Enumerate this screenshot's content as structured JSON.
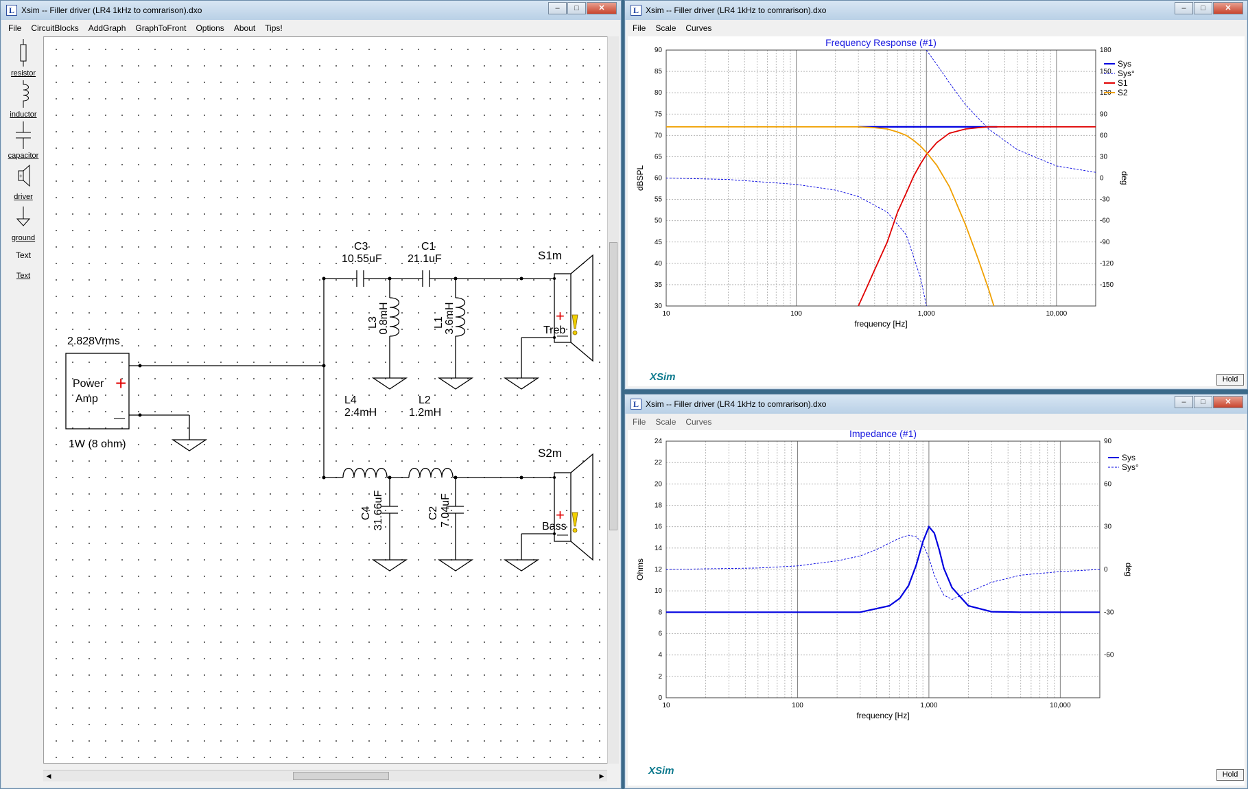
{
  "left_window": {
    "title": "Xsim -- Filler driver (LR4 1kHz to comrarison).dxo",
    "menu": [
      "File",
      "CircuitBlocks",
      "AddGraph",
      "GraphToFront",
      "Options",
      "About",
      "Tips!"
    ],
    "toolbox": [
      {
        "label": "resistor",
        "icon": "resistor-icon"
      },
      {
        "label": "inductor",
        "icon": "inductor-icon"
      },
      {
        "label": "capacitor",
        "icon": "capacitor-icon"
      },
      {
        "label": "driver",
        "icon": "driver-icon"
      },
      {
        "label": "ground",
        "icon": "ground-icon"
      },
      {
        "label": "Text",
        "icon": ""
      },
      {
        "label": "Text",
        "icon": ""
      }
    ],
    "schematic": {
      "source_voltage": "2.828Vrms",
      "amp_label_1": "Power",
      "amp_label_2": "Amp",
      "amp_power": "1W (8 ohm)",
      "plus": "+",
      "minus": "—",
      "c3_name": "C3",
      "c3_value": "10.55uF",
      "c1_name": "C1",
      "c1_value": "21.1uF",
      "l3_name": "L3",
      "l3_value": "0.8mH",
      "l1_name": "L1",
      "l1_value": "3.6mH",
      "s1_name": "S1m",
      "s1_label": "Treb",
      "l4_name": "L4",
      "l4_value": "2.4mH",
      "l2_name": "L2",
      "l2_value": "1.2mH",
      "c4_name": "C4",
      "c4_value": "31.66uF",
      "c2_name": "C2",
      "c2_value": "7.04uF",
      "s2_name": "S2m",
      "s2_label": "Bass"
    }
  },
  "fr_window": {
    "title": "Xsim -- Filler driver (LR4 1kHz to comrarison).dxo",
    "menu": [
      "File",
      "Scale",
      "Curves"
    ],
    "hold": "Hold",
    "logo": "XSim"
  },
  "z_window": {
    "title": "Xsim -- Filler driver (LR4 1kHz to comrarison).dxo",
    "menu": [
      "File",
      "Scale",
      "Curves"
    ],
    "hold": "Hold",
    "logo": "XSim"
  },
  "chart_data": [
    {
      "type": "line",
      "title": "Frequency Response (#1)",
      "xlabel": "frequency [Hz]",
      "ylabel": "dBSPL",
      "y2label": "deg",
      "xscale": "log",
      "xlim": [
        10,
        20000
      ],
      "ylim": [
        30,
        90
      ],
      "y2lim": [
        -180,
        180
      ],
      "xticks": [
        "10",
        "100",
        "1,000",
        "10,000"
      ],
      "yticks": [
        30,
        35,
        40,
        45,
        50,
        55,
        60,
        65,
        70,
        75,
        80,
        85,
        90
      ],
      "y2ticks": [
        -150,
        -120,
        -90,
        -60,
        -30,
        0,
        30,
        60,
        90,
        120,
        150,
        180
      ],
      "legend": "right",
      "grid": true,
      "series": [
        {
          "name": "Sys",
          "color": "#0000e0",
          "style": "solid",
          "axis": "left",
          "x": [
            300,
            500,
            1000,
            2000,
            3500
          ],
          "y": [
            72,
            72,
            72,
            72,
            72
          ]
        },
        {
          "name": "Sys°",
          "color": "#0000e0",
          "style": "dashed",
          "axis": "right",
          "x": [
            10,
            30,
            100,
            200,
            300,
            500,
            700,
            900,
            1000,
            1000,
            1200,
            1500,
            2000,
            3000,
            5000,
            10000,
            20000
          ],
          "y": [
            0,
            -2,
            -9,
            -17,
            -26,
            -48,
            -80,
            -140,
            -180,
            180,
            160,
            134,
            103,
            69,
            40,
            17,
            8
          ]
        },
        {
          "name": "S1",
          "color": "#e00000",
          "style": "solid",
          "axis": "left",
          "x": [
            300,
            350,
            400,
            500,
            600,
            700,
            800,
            900,
            1000,
            1200,
            1500,
            2000,
            2500,
            3000,
            5000,
            10000,
            20000
          ],
          "y": [
            30,
            34.5,
            38.5,
            45,
            52,
            56.5,
            60.5,
            63.3,
            65.5,
            68.3,
            70.5,
            71.5,
            71.8,
            72,
            72,
            72,
            72
          ]
        },
        {
          "name": "S2",
          "color": "#f0a000",
          "style": "solid",
          "axis": "left",
          "x": [
            10,
            100,
            300,
            400,
            500,
            600,
            700,
            800,
            900,
            1000,
            1200,
            1500,
            2000,
            2500,
            3000,
            3300
          ],
          "y": [
            72,
            72,
            72,
            71.8,
            71.5,
            70.8,
            70,
            68.8,
            67.5,
            66,
            63,
            58,
            49,
            41,
            34,
            30
          ]
        }
      ]
    },
    {
      "type": "line",
      "title": "Impedance (#1)",
      "xlabel": "frequency [Hz]",
      "ylabel": "Ohms",
      "y2label": "deg",
      "xscale": "log",
      "xlim": [
        10,
        20000
      ],
      "ylim": [
        0,
        24
      ],
      "y2lim": [
        -90,
        90
      ],
      "xticks": [
        "10",
        "100",
        "1,000",
        "10,000"
      ],
      "yticks": [
        0,
        2,
        4,
        6,
        8,
        10,
        12,
        14,
        16,
        18,
        20,
        22,
        24
      ],
      "y2ticks": [
        -60,
        -30,
        0,
        30,
        60,
        90
      ],
      "legend": "right",
      "grid": true,
      "series": [
        {
          "name": "Sys",
          "color": "#0000e0",
          "style": "solid",
          "axis": "left",
          "x": [
            10,
            100,
            300,
            500,
            600,
            700,
            800,
            900,
            1000,
            1100,
            1200,
            1300,
            1500,
            2000,
            3000,
            5000,
            20000
          ],
          "y": [
            8,
            8,
            8,
            8.6,
            9.3,
            10.5,
            12.4,
            14.6,
            16,
            15.4,
            13.8,
            12.1,
            10.3,
            8.6,
            8.05,
            8,
            8
          ]
        },
        {
          "name": "Sys°",
          "color": "#0000e0",
          "style": "dashed",
          "axis": "right",
          "x": [
            10,
            50,
            100,
            200,
            300,
            400,
            500,
            600,
            700,
            800,
            900,
            1000,
            1100,
            1200,
            1300,
            1500,
            2000,
            3000,
            5000,
            10000,
            20000
          ],
          "y": [
            0,
            1,
            2.5,
            6,
            9.5,
            14,
            18.5,
            22,
            24,
            23,
            18,
            8,
            -4,
            -12,
            -18,
            -21,
            -16,
            -9,
            -4,
            -1.5,
            0
          ]
        }
      ]
    }
  ]
}
